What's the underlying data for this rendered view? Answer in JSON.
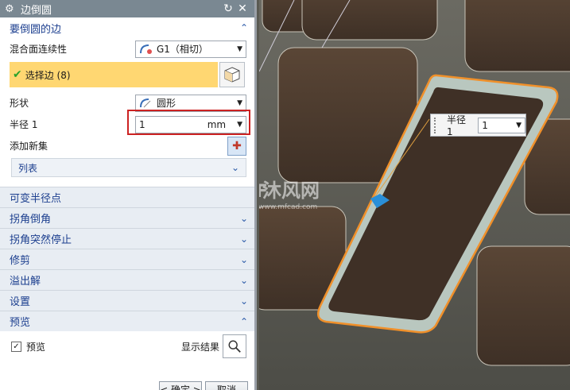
{
  "dialog": {
    "title": "边倒圆",
    "icons": {
      "settings": "gear-icon",
      "reset": "reset-icon",
      "close": "close-icon"
    }
  },
  "edge_section": {
    "header": "要倒圆的边",
    "continuity_label": "混合面连续性",
    "continuity_value": "G1（相切）",
    "select_edge_label": "选择边 (8)",
    "shape_label": "形状",
    "shape_value": "圆形",
    "radius_label": "半径 1",
    "radius_value": "1",
    "radius_unit": "mm",
    "add_set_label": "添加新集",
    "list_label": "列表"
  },
  "collapsed_sections": [
    {
      "label": "可变半径点"
    },
    {
      "label": "拐角倒角"
    },
    {
      "label": "拐角突然停止"
    },
    {
      "label": "修剪"
    },
    {
      "label": "溢出解"
    },
    {
      "label": "设置"
    }
  ],
  "preview_section": {
    "header": "预览",
    "preview_checkbox_label": "预览",
    "preview_checked": true,
    "show_result_label": "显示结果"
  },
  "footer": {
    "ok_label": "< 确定 >",
    "cancel_label": "取消"
  },
  "viewport": {
    "radius_popup_label": "半径 1",
    "radius_popup_value": "1",
    "watermark_cn": "沐风网",
    "watermark_en": "www.mfcad.com"
  },
  "colors": {
    "accent": "#1c3f8f",
    "selection_highlight": "#ffd772",
    "edge_highlight": "#f0902a",
    "model_surface": "#4a3a2c",
    "background": "#5a5a52"
  }
}
